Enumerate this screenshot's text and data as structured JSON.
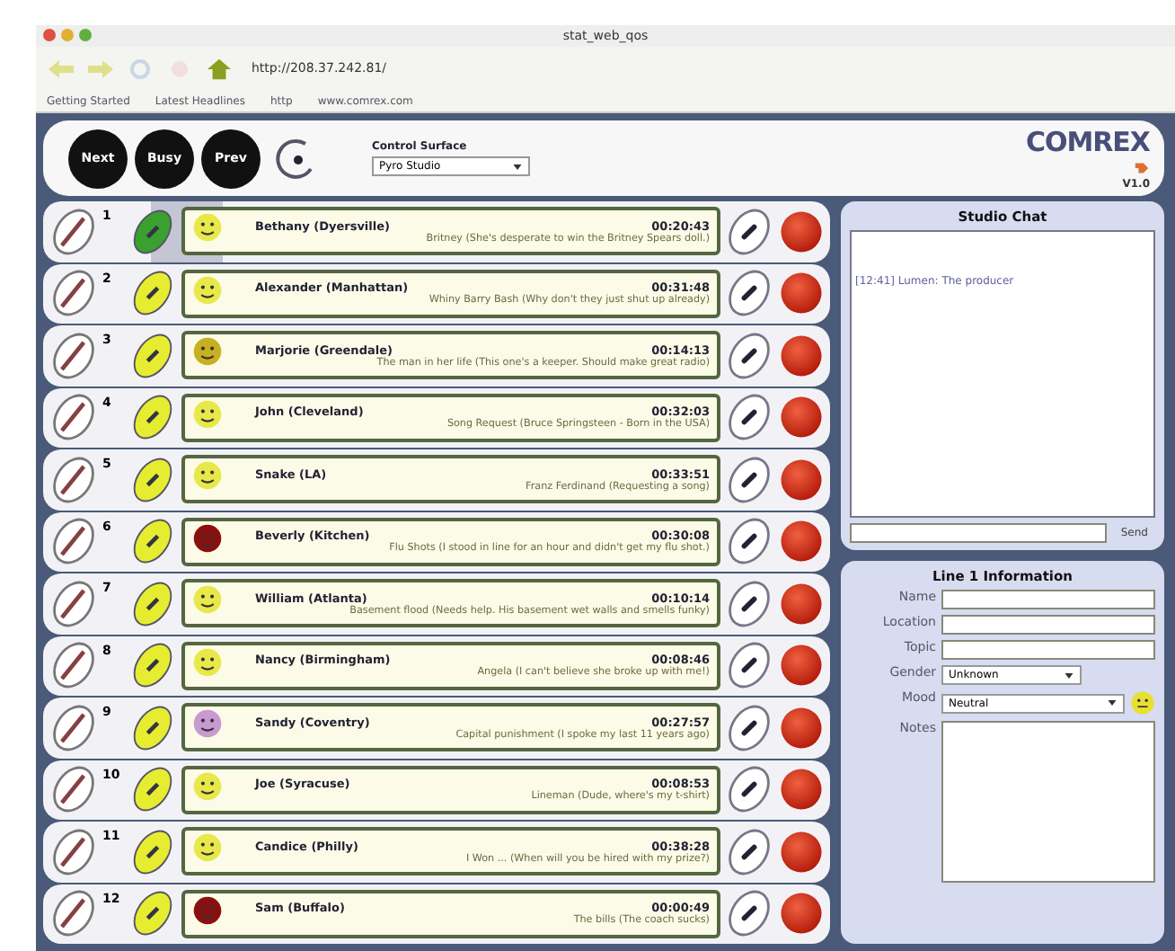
{
  "browser": {
    "title": "stat_web_qos",
    "url": "http://208.37.242.81/",
    "bookmarks": [
      "Getting Started",
      "Latest Headlines",
      "http",
      "www.comrex.com"
    ]
  },
  "header": {
    "buttons": [
      "Next",
      "Busy",
      "Prev"
    ],
    "control_surface_label": "Control Surface",
    "control_surface": "Pyro Studio",
    "logo": "COMREX",
    "version": "V1.0"
  },
  "lines": [
    {
      "number": "1",
      "name": "Bethany (Dyersville)",
      "time": "00:20:43",
      "topic": "Britney (She's desperate to win the Britney Spears doll.)",
      "selected": true,
      "color": "#e8e84a"
    },
    {
      "number": "2",
      "name": "Alexander (Manhattan)",
      "time": "00:31:48",
      "topic": "Whiny Barry Bash (Why don't they just shut up already)",
      "selected": false,
      "color": "#e8e84a"
    },
    {
      "number": "3",
      "name": "Marjorie (Greendale)",
      "time": "00:14:13",
      "topic": "The man in her life (This one's a keeper. Should make great radio)",
      "selected": false,
      "color": "#c8b020"
    },
    {
      "number": "4",
      "name": "John (Cleveland)",
      "time": "00:32:03",
      "topic": "Song Request (Bruce Springsteen - Born in the USA)",
      "selected": false,
      "color": "#e8e84a"
    },
    {
      "number": "5",
      "name": "Snake (LA)",
      "time": "00:33:51",
      "topic": "Franz Ferdinand (Requesting a song)",
      "selected": false,
      "color": "#e8e84a"
    },
    {
      "number": "6",
      "name": "Beverly (Kitchen)",
      "time": "00:30:08",
      "topic": "Flu Shots (I stood in line for an hour and didn't get my flu shot.)",
      "selected": false,
      "color": "#8a1010"
    },
    {
      "number": "7",
      "name": "William (Atlanta)",
      "time": "00:10:14",
      "topic": "Basement flood (Needs help. His basement wet walls and smells funky)",
      "selected": false,
      "color": "#e8e84a"
    },
    {
      "number": "8",
      "name": "Nancy (Birmingham)",
      "time": "00:08:46",
      "topic": "Angela (I can't believe she broke up with me!)",
      "selected": false,
      "color": "#e8e84a"
    },
    {
      "number": "9",
      "name": "Sandy (Coventry)",
      "time": "00:27:57",
      "topic": "Capital punishment (I spoke my last 11 years ago)",
      "selected": false,
      "color": "#c89ad0"
    },
    {
      "number": "10",
      "name": "Joe (Syracuse)",
      "time": "00:08:53",
      "topic": "Lineman (Dude, where's my t-shirt)",
      "selected": false,
      "color": "#e8e84a"
    },
    {
      "number": "11",
      "name": "Candice (Philly)",
      "time": "00:38:28",
      "topic": "I Won ... (When will you be hired with my prize?)",
      "selected": false,
      "color": "#e8e84a"
    },
    {
      "number": "12",
      "name": "Sam (Buffalo)",
      "time": "00:00:49",
      "topic": "The bills (The coach sucks)",
      "selected": false,
      "color": "#8a1010"
    }
  ],
  "chat": {
    "title": "Studio Chat",
    "messages": [
      "[12:41] Lumen: The producer"
    ],
    "send": "Send"
  },
  "info": {
    "title": "Line 1 Information",
    "fields": [
      {
        "label": "Name",
        "kind": "text"
      },
      {
        "label": "Location",
        "kind": "text"
      },
      {
        "label": "Topic",
        "kind": "text"
      },
      {
        "label": "Gender",
        "kind": "select",
        "value": "Unknown"
      },
      {
        "label": "Mood",
        "kind": "mood",
        "value": "Neutral"
      },
      {
        "label": "Notes",
        "kind": "area"
      }
    ]
  }
}
